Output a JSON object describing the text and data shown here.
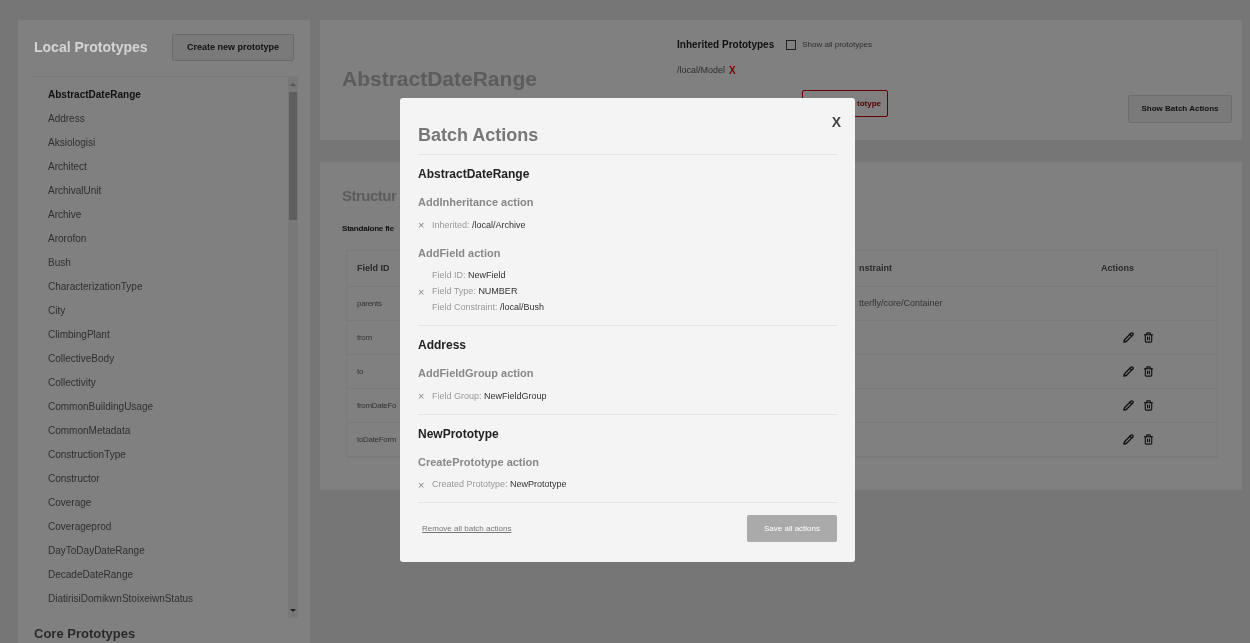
{
  "local_prototypes": {
    "title": "Local Prototypes",
    "create_button": "Create new prototype",
    "items": [
      {
        "label": "AbstractDateRange",
        "selected": true
      },
      {
        "label": "Address",
        "selected": false
      },
      {
        "label": "Aksiologisi",
        "selected": false
      },
      {
        "label": "Architect",
        "selected": false
      },
      {
        "label": "ArchivalUnit",
        "selected": false
      },
      {
        "label": "Archive",
        "selected": false
      },
      {
        "label": "Arorofon",
        "selected": false
      },
      {
        "label": "Bush",
        "selected": false
      },
      {
        "label": "CharacterizationType",
        "selected": false
      },
      {
        "label": "City",
        "selected": false
      },
      {
        "label": "ClimbingPlant",
        "selected": false
      },
      {
        "label": "CollectiveBody",
        "selected": false
      },
      {
        "label": "Collectivity",
        "selected": false
      },
      {
        "label": "CommonBuildingUsage",
        "selected": false
      },
      {
        "label": "CommonMetadata",
        "selected": false
      },
      {
        "label": "ConstructionType",
        "selected": false
      },
      {
        "label": "Constructor",
        "selected": false
      },
      {
        "label": "Coverage",
        "selected": false
      },
      {
        "label": "Coverageprod",
        "selected": false
      },
      {
        "label": "DayToDayDateRange",
        "selected": false
      },
      {
        "label": "DecadeDateRange",
        "selected": false
      },
      {
        "label": "DiatirisiDomikwnStoixeiwnStatus",
        "selected": false
      }
    ],
    "core_title": "Core Prototypes"
  },
  "prototype": {
    "title": "AbstractDateRange",
    "inherited_title": "Inherited Prototypes",
    "show_all": {
      "label": "Show all prototypes",
      "checked": false
    },
    "inherited": [
      {
        "path": "/local/Model",
        "remove": "X"
      }
    ],
    "remove_button": "totype",
    "batch_button": "Show Batch Actions"
  },
  "structure": {
    "title": "Structur",
    "subtitle": "Standalone fie",
    "columns": {
      "field_id": "Field ID",
      "constraint": "nstraint",
      "actions": "Actions"
    },
    "rows": [
      {
        "field_id": "parents",
        "constraint": "tterfly/core/Container",
        "editable": false
      },
      {
        "field_id": "from",
        "editable": true
      },
      {
        "field_id": "to",
        "editable": true
      },
      {
        "field_id": "fromDateFo",
        "editable": true
      },
      {
        "field_id": "toDateForm",
        "editable": true
      }
    ]
  },
  "modal": {
    "title": "Batch Actions",
    "close": "X",
    "groups": [
      {
        "name": "AbstractDateRange",
        "actions": [
          {
            "title": "AddInheritance action",
            "lines": [
              {
                "mark": "×",
                "label": "Inherited:",
                "value": "/local/Archive"
              }
            ]
          },
          {
            "title": "AddField action",
            "lines": [
              {
                "label": "Field ID:",
                "value": "NewField"
              },
              {
                "mark": "×",
                "label": "Field Type:",
                "value": "NUMBER"
              },
              {
                "label": "Field Constraint:",
                "value": "/local/Bush"
              }
            ]
          }
        ]
      },
      {
        "name": "Address",
        "actions": [
          {
            "title": "AddFieldGroup action",
            "lines": [
              {
                "mark": "×",
                "label": "Field Group:",
                "value": "NewFieldGroup"
              }
            ]
          }
        ]
      },
      {
        "name": "NewPrototype",
        "actions": [
          {
            "title": "CreatePrototype action",
            "lines": [
              {
                "mark": "×",
                "label": "Created Prototype:",
                "value": "NewPrototype"
              }
            ]
          }
        ]
      }
    ],
    "remove_link": "Remove all batch actions",
    "save_button": "Save all actions"
  }
}
